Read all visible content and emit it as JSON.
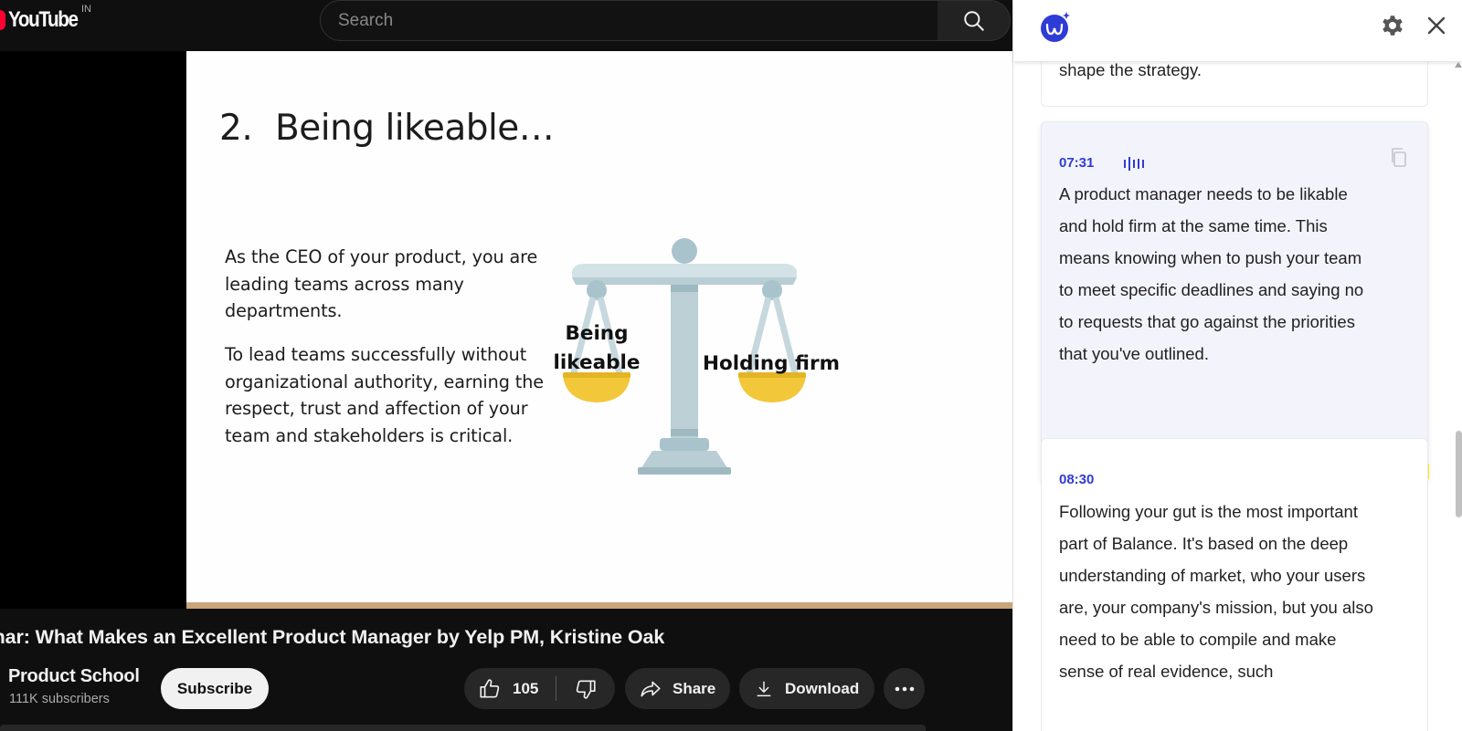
{
  "youtube": {
    "logo_text": "YouTube",
    "country_code": "IN",
    "search_placeholder": "Search"
  },
  "slide": {
    "title_number": "2.",
    "title_text": "Being likeable…",
    "paragraph_1": "As the CEO of your product, you are leading teams across many departments.",
    "paragraph_2": "To lead teams successfully without organizational authority, earning the respect, trust and affection of your team and stakeholders is critical.",
    "scale_left_label_line1": "Being",
    "scale_left_label_line2": "likeable",
    "scale_right_label": "Holding firm"
  },
  "video_info": {
    "title": "Webinar: What Makes an Excellent Product Manager by Yelp PM, Kristine Oak",
    "channel_name": "Product School",
    "subscribers": "111K subscribers",
    "subscribe_label": "Subscribe",
    "like_count": "105",
    "share_label": "Share",
    "download_label": "Download"
  },
  "transcript_panel": {
    "previous_card_text": "shape the strategy.",
    "active_card": {
      "time": "07:31",
      "text": "A product manager needs to be likable and hold firm at the same time. This means knowing when to push your team to meet specific deadlines and saying no to requests that go against the priorities that you've outlined."
    },
    "next_card": {
      "time": "08:30",
      "text": "Following your gut is the most important part of Balance. It's based on the deep understanding of market, who your users are, your company's mission, but you also need to be able to compile and make sense of real evidence, such"
    }
  },
  "colors": {
    "youtube_red": "#ff0033",
    "panel_accent": "#2f3bd6",
    "highlight": "#f6f000",
    "slide_scale_pan": "#f2c73a",
    "slide_scale_body": "#b8cdd4"
  },
  "icons": {
    "search": "search-icon",
    "like": "thumbs-up-icon",
    "dislike": "thumbs-down-icon",
    "share": "share-arrow-icon",
    "download": "download-icon",
    "more": "more-horizontal-icon",
    "settings": "gear-icon",
    "close": "close-icon",
    "copy": "copy-icon",
    "audio": "audio-wave-icon"
  }
}
